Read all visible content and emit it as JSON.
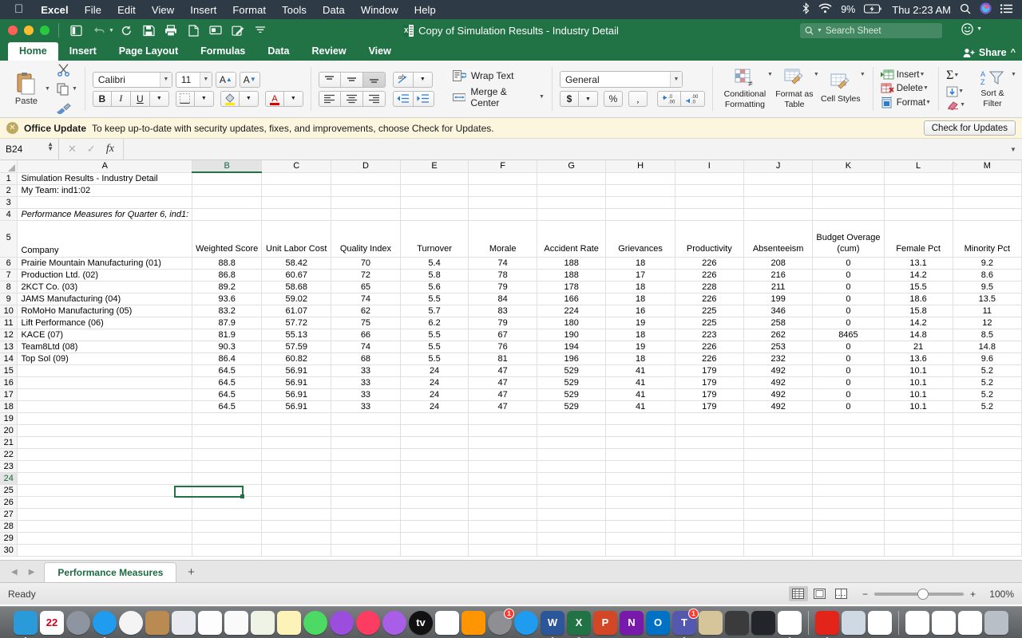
{
  "menubar": {
    "apple": "apple-logo",
    "items": [
      "Excel",
      "File",
      "Edit",
      "View",
      "Insert",
      "Format",
      "Tools",
      "Data",
      "Window",
      "Help"
    ],
    "battery_pct": "9%",
    "clock": "Thu 2:23 AM",
    "icons": [
      "bluetooth-icon",
      "wifi-icon",
      "battery-icon",
      "spotlight-icon",
      "siri-icon",
      "control-center-icon"
    ]
  },
  "window": {
    "title": "Copy of Simulation Results - Industry Detail",
    "search_placeholder": "Search Sheet",
    "quick_access": [
      "sidebar-toggle",
      "undo",
      "redo",
      "save",
      "print",
      "new",
      "comment",
      "edit",
      "customize"
    ]
  },
  "ribbon": {
    "tabs": [
      "Home",
      "Insert",
      "Page Layout",
      "Formulas",
      "Data",
      "Review",
      "View"
    ],
    "active_tab": "Home",
    "share_label": "Share",
    "clipboard": {
      "paste_label": "Paste"
    },
    "font": {
      "family": "Calibri",
      "size": "11",
      "grow": "A",
      "shrink": "A",
      "bold": "B",
      "italic": "I",
      "underline": "U"
    },
    "alignment": {
      "wrap_text": "Wrap Text",
      "merge_center": "Merge & Center"
    },
    "number": {
      "format": "General",
      "currency": "$",
      "percent": "%",
      "comma": ",",
      "inc_dec": ".00",
      "dec_dec": ".00"
    },
    "styles": {
      "conditional": "Conditional Formatting",
      "table": "Format as Table",
      "cell": "Cell Styles"
    },
    "cells": {
      "insert": "Insert",
      "delete": "Delete",
      "format": "Format"
    },
    "editing": {
      "sort_filter": "Sort & Filter"
    }
  },
  "notification": {
    "title": "Office Update",
    "message": "To keep up-to-date with security updates, fixes, and improvements, choose Check for Updates.",
    "button": "Check for Updates"
  },
  "formula_bar": {
    "name_box": "B24",
    "formula": "",
    "fx": "fx"
  },
  "sheet": {
    "column_letters": [
      "A",
      "B",
      "C",
      "D",
      "E",
      "F",
      "G",
      "H",
      "I",
      "J",
      "K",
      "L",
      "M"
    ],
    "selected_column": "B",
    "selected_row": 24,
    "row_numbers": [
      1,
      2,
      3,
      4,
      5,
      6,
      7,
      8,
      9,
      10,
      11,
      12,
      13,
      14,
      15,
      16,
      17,
      18,
      19,
      20,
      21,
      22,
      23,
      24,
      25,
      26,
      27,
      28,
      29,
      30
    ],
    "title_a1": "Simulation Results - Industry Detail",
    "title_a2": "My Team: ind1:02",
    "title_a4": "Performance Measures for Quarter 6, ind1:",
    "headers": [
      "Company",
      "Weighted Score",
      "Unit Labor Cost",
      "Quality Index",
      "Turnover",
      "Morale",
      "Accident Rate",
      "Grievances",
      "Productivity",
      "Absenteeism",
      "Budget Overage (cum)",
      "Female Pct",
      "Minority Pct"
    ],
    "rows": [
      [
        "Prairie Mountain Manufacturing (01)",
        "88.8",
        "58.42",
        "70",
        "5.4",
        "74",
        "188",
        "18",
        "226",
        "208",
        "0",
        "13.1",
        "9.2"
      ],
      [
        "Production Ltd. (02)",
        "86.8",
        "60.67",
        "72",
        "5.8",
        "78",
        "188",
        "17",
        "226",
        "216",
        "0",
        "14.2",
        "8.6"
      ],
      [
        "2KCT Co. (03)",
        "89.2",
        "58.68",
        "65",
        "5.6",
        "79",
        "178",
        "18",
        "228",
        "211",
        "0",
        "15.5",
        "9.5"
      ],
      [
        "JAMS Manufacturing (04)",
        "93.6",
        "59.02",
        "74",
        "5.5",
        "84",
        "166",
        "18",
        "226",
        "199",
        "0",
        "18.6",
        "13.5"
      ],
      [
        "RoMoHo Manufacturing (05)",
        "83.2",
        "61.07",
        "62",
        "5.7",
        "83",
        "224",
        "16",
        "225",
        "346",
        "0",
        "15.8",
        "11"
      ],
      [
        "Lift Performance (06)",
        "87.9",
        "57.72",
        "75",
        "6.2",
        "79",
        "180",
        "19",
        "225",
        "258",
        "0",
        "14.2",
        "12"
      ],
      [
        "KACE (07)",
        "81.9",
        "55.13",
        "66",
        "5.5",
        "67",
        "190",
        "18",
        "223",
        "262",
        "8465",
        "14.8",
        "8.5"
      ],
      [
        "Team8Ltd (08)",
        "90.3",
        "57.59",
        "74",
        "5.5",
        "76",
        "194",
        "19",
        "226",
        "253",
        "0",
        "21",
        "14.8"
      ],
      [
        "Top Sol (09)",
        "86.4",
        "60.82",
        "68",
        "5.5",
        "81",
        "196",
        "18",
        "226",
        "232",
        "0",
        "13.6",
        "9.6"
      ],
      [
        "",
        "64.5",
        "56.91",
        "33",
        "24",
        "47",
        "529",
        "41",
        "179",
        "492",
        "0",
        "10.1",
        "5.2"
      ],
      [
        "",
        "64.5",
        "56.91",
        "33",
        "24",
        "47",
        "529",
        "41",
        "179",
        "492",
        "0",
        "10.1",
        "5.2"
      ],
      [
        "",
        "64.5",
        "56.91",
        "33",
        "24",
        "47",
        "529",
        "41",
        "179",
        "492",
        "0",
        "10.1",
        "5.2"
      ],
      [
        "",
        "64.5",
        "56.91",
        "33",
        "24",
        "47",
        "529",
        "41",
        "179",
        "492",
        "0",
        "10.1",
        "5.2"
      ]
    ]
  },
  "sheet_tabs": {
    "tabs": [
      "Performance Measures"
    ],
    "active": "Performance Measures",
    "add_label": "+"
  },
  "status_bar": {
    "status": "Ready",
    "zoom": "100%",
    "views": [
      "normal-view",
      "page-layout-view",
      "page-break-view"
    ]
  },
  "dock": {
    "items": [
      {
        "name": "finder",
        "label": "",
        "color": "#2a9bd8",
        "running": true
      },
      {
        "name": "calendar",
        "label": "22",
        "color": "#ffffff",
        "running": false
      },
      {
        "name": "launchpad",
        "label": "",
        "color": "#8d96a0",
        "running": false
      },
      {
        "name": "safari",
        "label": "",
        "color": "#1f9cf0",
        "running": true
      },
      {
        "name": "chrome",
        "label": "",
        "color": "#f4f4f4",
        "running": false
      },
      {
        "name": "contacts",
        "label": "",
        "color": "#b98a52",
        "running": false
      },
      {
        "name": "preview",
        "label": "",
        "color": "#e8eaf0",
        "running": false
      },
      {
        "name": "photos",
        "label": "",
        "color": "#fdfdfd",
        "running": false
      },
      {
        "name": "reminders",
        "label": "",
        "color": "#fafafa",
        "running": false
      },
      {
        "name": "maps",
        "label": "",
        "color": "#eef3e6",
        "running": false
      },
      {
        "name": "notes",
        "label": "",
        "color": "#fdf2b8",
        "running": false
      },
      {
        "name": "messages",
        "label": "",
        "color": "#4cd964",
        "running": false
      },
      {
        "name": "podcasts",
        "label": "",
        "color": "#9b4dde",
        "running": false
      },
      {
        "name": "music",
        "label": "",
        "color": "#fc3c60",
        "running": false
      },
      {
        "name": "itunes",
        "label": "",
        "color": "#a95ee8",
        "running": false
      },
      {
        "name": "apple-tv",
        "label": "tv",
        "color": "#111111",
        "running": false
      },
      {
        "name": "news",
        "label": "",
        "color": "#ffffff",
        "running": false
      },
      {
        "name": "books",
        "label": "",
        "color": "#ff9500",
        "running": false
      },
      {
        "name": "system-preferences",
        "label": "",
        "color": "#8e8e93",
        "running": false,
        "badge": "1"
      },
      {
        "name": "app-store",
        "label": "",
        "color": "#1f9cf0",
        "running": false
      },
      {
        "name": "word",
        "label": "W",
        "color": "#2b579a",
        "running": true
      },
      {
        "name": "excel",
        "label": "X",
        "color": "#217346",
        "running": true
      },
      {
        "name": "powerpoint",
        "label": "P",
        "color": "#d24726",
        "running": false
      },
      {
        "name": "onenote",
        "label": "N",
        "color": "#7719aa",
        "running": false
      },
      {
        "name": "outlook",
        "label": "O",
        "color": "#0072c6",
        "running": false
      },
      {
        "name": "teams",
        "label": "T",
        "color": "#5558af",
        "running": true,
        "badge": "1"
      },
      {
        "name": "chess",
        "label": "",
        "color": "#d6c49a",
        "running": false
      },
      {
        "name": "audio-midi",
        "label": "",
        "color": "#3b3b3b",
        "running": false
      },
      {
        "name": "keyboard-app",
        "label": "",
        "color": "#22252a",
        "running": false
      },
      {
        "name": "messenger",
        "label": "",
        "color": "#ffffff",
        "running": true
      },
      {
        "name": "acrobat",
        "label": "",
        "color": "#e3241b",
        "running": true
      },
      {
        "name": "image-capture",
        "label": "",
        "color": "#cfd9e4",
        "running": false
      },
      {
        "name": "document-pdf",
        "label": "",
        "color": "#ffffff",
        "running": false
      },
      {
        "name": "document-word-1",
        "label": "",
        "color": "#ffffff",
        "running": false
      },
      {
        "name": "document-word-2",
        "label": "",
        "color": "#ffffff",
        "running": false
      },
      {
        "name": "document-web",
        "label": "",
        "color": "#ffffff",
        "running": false
      },
      {
        "name": "trash",
        "label": "",
        "color": "#b9bfc6",
        "running": false
      }
    ]
  }
}
